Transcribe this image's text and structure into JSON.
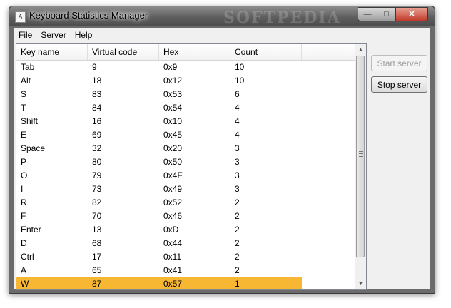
{
  "window": {
    "title": "Keyboard Statistics Manager",
    "icon_label": "A",
    "watermark": "SOFTPEDIA"
  },
  "menu": [
    {
      "label": "File"
    },
    {
      "label": "Server"
    },
    {
      "label": "Help"
    }
  ],
  "table": {
    "columns": [
      "Key name",
      "Virtual code",
      "Hex",
      "Count"
    ],
    "rows": [
      {
        "key": "Tab",
        "code": "9",
        "hex": "0x9",
        "count": "10"
      },
      {
        "key": "Alt",
        "code": "18",
        "hex": "0x12",
        "count": "10"
      },
      {
        "key": "S",
        "code": "83",
        "hex": "0x53",
        "count": "6"
      },
      {
        "key": "T",
        "code": "84",
        "hex": "0x54",
        "count": "4"
      },
      {
        "key": "Shift",
        "code": "16",
        "hex": "0x10",
        "count": "4"
      },
      {
        "key": "E",
        "code": "69",
        "hex": "0x45",
        "count": "4"
      },
      {
        "key": "Space",
        "code": "32",
        "hex": "0x20",
        "count": "3"
      },
      {
        "key": "P",
        "code": "80",
        "hex": "0x50",
        "count": "3"
      },
      {
        "key": "O",
        "code": "79",
        "hex": "0x4F",
        "count": "3"
      },
      {
        "key": "I",
        "code": "73",
        "hex": "0x49",
        "count": "3"
      },
      {
        "key": "R",
        "code": "82",
        "hex": "0x52",
        "count": "2"
      },
      {
        "key": "F",
        "code": "70",
        "hex": "0x46",
        "count": "2"
      },
      {
        "key": "Enter",
        "code": "13",
        "hex": "0xD",
        "count": "2"
      },
      {
        "key": "D",
        "code": "68",
        "hex": "0x44",
        "count": "2"
      },
      {
        "key": "Ctrl",
        "code": "17",
        "hex": "0x11",
        "count": "2"
      },
      {
        "key": "A",
        "code": "65",
        "hex": "0x41",
        "count": "2"
      },
      {
        "key": "W",
        "code": "87",
        "hex": "0x57",
        "count": "1",
        "selected": true
      }
    ]
  },
  "buttons": {
    "start_server": "Start server",
    "stop_server": "Stop server"
  },
  "colors": {
    "selection": "#f7b733"
  },
  "icons": {
    "minimize": "minimize-icon",
    "maximize": "maximize-icon",
    "close": "close-icon",
    "scroll_up": "chevron-up-icon",
    "scroll_down": "chevron-down-icon"
  }
}
